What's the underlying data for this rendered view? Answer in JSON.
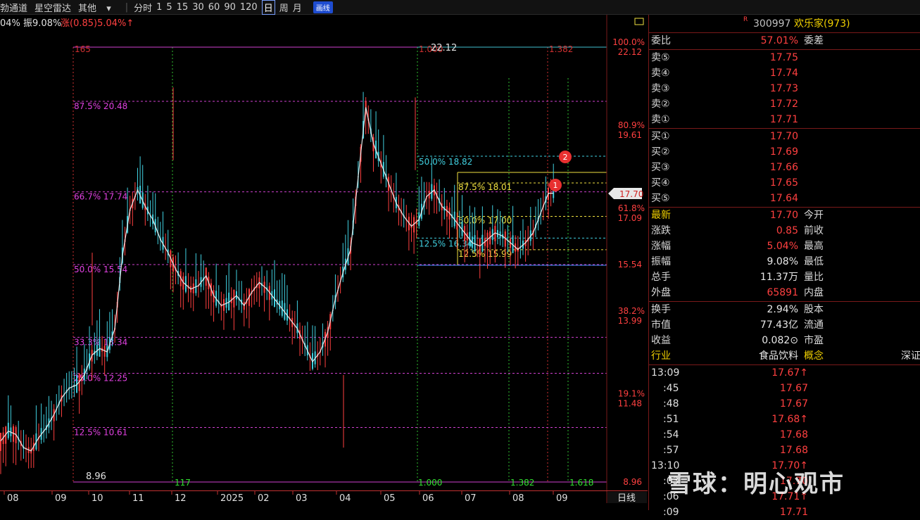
{
  "toolbar": {
    "items": [
      "勃通道",
      "星空雷达",
      "其他"
    ],
    "dropdown_arrow": "▾",
    "periods": [
      "分时",
      "1",
      "5",
      "15",
      "30",
      "60",
      "90",
      "120",
      "日",
      "周",
      "月"
    ],
    "active_period": "日",
    "draw_button": "画线"
  },
  "header_info": {
    "left": "04% 振9.08%",
    "change": "涨(0.85)5.04%↑"
  },
  "fib_left": {
    "top_label": "165",
    "levels": [
      {
        "label": "87.5% 20.48",
        "price": 20.48
      },
      {
        "label": "66.7% 17.74",
        "price": 17.74
      },
      {
        "label": "50.0% 15.54",
        "price": 15.54
      },
      {
        "label": "33.3% 13.34",
        "price": 13.34
      },
      {
        "label": "25.0% 12.25",
        "price": 12.25
      },
      {
        "label": "12.5% 10.61",
        "price": 10.61
      }
    ],
    "low_label": "8.96"
  },
  "fib_right": {
    "top_label": "22.12",
    "levels": [
      {
        "label": "50.0% 18.82",
        "price": 18.82,
        "color": "#40d0e0"
      },
      {
        "label": "12.5% 16.34",
        "price": 16.34,
        "color": "#40d0e0"
      },
      {
        "label": "87.5% 18.01",
        "price": 18.01,
        "color": "#f0e040"
      },
      {
        "label": "50.0% 17.00",
        "price": 17.0,
        "color": "#f0e040"
      },
      {
        "label": "12.5% 15.99",
        "price": 15.99,
        "color": "#f0e040"
      }
    ],
    "time_labels": [
      "117",
      "1.000",
      "1.382",
      "1.618"
    ],
    "top_ratio_labels": [
      "1.000",
      "1.382"
    ],
    "markers": [
      "1",
      "2"
    ]
  },
  "axis_right": [
    {
      "pct": "100.0%",
      "price": "22.12"
    },
    {
      "pct": "80.9%",
      "price": "19.61"
    },
    {
      "pct": "61.8%",
      "price": "17.09"
    },
    {
      "pct": "",
      "price": "15.54"
    },
    {
      "pct": "38.2%",
      "price": "13.99"
    },
    {
      "pct": "19.1%",
      "price": "11.48"
    },
    {
      "pct": "",
      "price": "8.96"
    }
  ],
  "current_price_tag": "17.70",
  "x_axis": [
    "08",
    "09",
    "10",
    "11",
    "12",
    "2025",
    "02",
    "03",
    "04",
    "05",
    "06",
    "07",
    "08",
    "09"
  ],
  "x_axis_suffix": "日线",
  "x_axis_marker": "$",
  "panel": {
    "title_mark": "R",
    "code": "300997",
    "name": "欢乐家(973)",
    "weibi": {
      "label": "委比",
      "value": "57.01%",
      "label2": "委差"
    },
    "asks": [
      {
        "label": "卖⑤",
        "price": "17.75"
      },
      {
        "label": "卖④",
        "price": "17.74"
      },
      {
        "label": "卖③",
        "price": "17.73"
      },
      {
        "label": "卖②",
        "price": "17.72"
      },
      {
        "label": "卖①",
        "price": "17.71"
      }
    ],
    "bids": [
      {
        "label": "买①",
        "price": "17.70"
      },
      {
        "label": "买②",
        "price": "17.69"
      },
      {
        "label": "买③",
        "price": "17.66"
      },
      {
        "label": "买④",
        "price": "17.65"
      },
      {
        "label": "买⑤",
        "price": "17.64"
      }
    ],
    "stats": [
      {
        "label": "最新",
        "value": "17.70",
        "label2": "今开",
        "color": "red"
      },
      {
        "label": "涨跌",
        "value": "0.85",
        "label2": "前收",
        "color": "red"
      },
      {
        "label": "涨幅",
        "value": "5.04%",
        "label2": "最高",
        "color": "red"
      },
      {
        "label": "振幅",
        "value": "9.08%",
        "label2": "最低",
        "color": "white"
      },
      {
        "label": "总手",
        "value": "11.37万",
        "label2": "量比",
        "color": "white"
      },
      {
        "label": "外盘",
        "value": "65891",
        "label2": "内盘",
        "color": "red"
      }
    ],
    "stats2": [
      {
        "label": "换手",
        "value": "2.94%",
        "label2": "股本"
      },
      {
        "label": "市值",
        "value": "77.43亿",
        "label2": "流通"
      },
      {
        "label": "收益",
        "value": "0.082⊙",
        "label2": "市盈"
      }
    ],
    "industry": {
      "label": "行业",
      "value": "食品饮料",
      "label2": "概念",
      "extra": "深证"
    },
    "ticks": [
      {
        "time": "13:09",
        "price": "17.67↑"
      },
      {
        "time": ":45",
        "price": "17.67"
      },
      {
        "time": ":48",
        "price": "17.67"
      },
      {
        "time": ":51",
        "price": "17.68↑"
      },
      {
        "time": ":54",
        "price": "17.68"
      },
      {
        "time": ":57",
        "price": "17.68"
      },
      {
        "time": "13:10",
        "price": "17.70↑"
      },
      {
        "time": ":03",
        "price": "17.70"
      },
      {
        "time": ":06",
        "price": "17.71↑"
      },
      {
        "time": ":09",
        "price": "17.71"
      }
    ]
  },
  "watermark": "雪球：明心观市",
  "colors": {
    "up": "#ff4040",
    "down": "#40d0e0",
    "fib_magenta": "#d040d0",
    "fib_yellow": "#f0e040",
    "ma": "#e8e8e8"
  },
  "chart_data": {
    "type": "candlestick",
    "title": "",
    "ylim": [
      8.96,
      22.12
    ],
    "x_ticks": [
      "08",
      "09",
      "10",
      "11",
      "12",
      "2025",
      "02",
      "03",
      "04",
      "05",
      "06",
      "07",
      "08",
      "09"
    ],
    "close_path": [
      10.2,
      10.5,
      10.4,
      10.0,
      9.9,
      10.3,
      10.6,
      11.0,
      11.5,
      11.8,
      11.9,
      12.2,
      12.8,
      13.0,
      12.9,
      13.6,
      15.8,
      17.2,
      17.8,
      17.3,
      16.9,
      16.3,
      15.9,
      15.4,
      15.0,
      14.8,
      14.9,
      15.2,
      14.6,
      14.3,
      14.4,
      14.6,
      14.3,
      14.7,
      15.0,
      14.8,
      14.5,
      14.2,
      13.9,
      13.6,
      13.1,
      12.6,
      12.9,
      13.5,
      14.5,
      15.3,
      16.0,
      18.2,
      20.3,
      19.2,
      18.6,
      18.0,
      17.4,
      17.0,
      16.7,
      16.9,
      17.6,
      17.8,
      17.3,
      17.1,
      16.8,
      16.5,
      16.2,
      16.1,
      16.3,
      16.5,
      16.4,
      16.2,
      16.0,
      16.2,
      16.5,
      17.1,
      17.7
    ]
  }
}
